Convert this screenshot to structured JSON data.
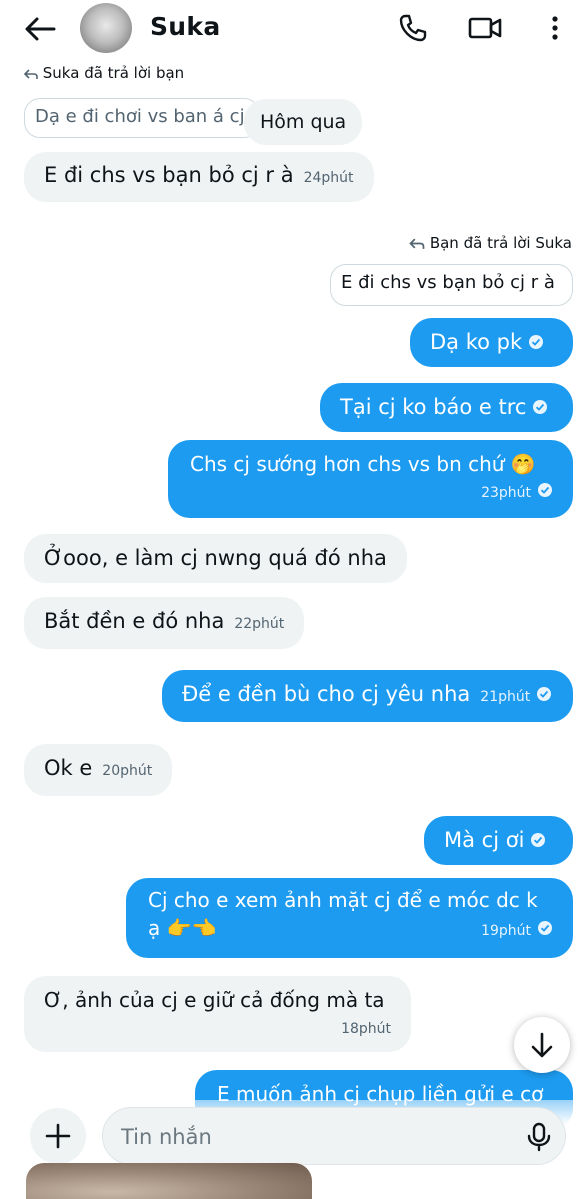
{
  "header": {
    "name": "Suka",
    "back_icon": "arrow-left-icon",
    "call_icon": "phone-icon",
    "video_icon": "video-camera-icon",
    "more_icon": "more-vertical-icon"
  },
  "thread": {
    "top_reply_label": "Suka đã trả lời bạn",
    "top_quote": "Dạ e đi chơi vs ban á cj",
    "date_pill": "Hôm qua",
    "m1": {
      "text": "E đi chs vs bạn bỏ cj r à",
      "time": "24phút"
    },
    "self_reply_label": "Bạn đã trả lời Suka",
    "self_quote": "E đi chs vs bạn bỏ cj r à",
    "m2": {
      "text": "Dạ ko pk"
    },
    "m3": {
      "text": "Tại cj ko báo e trc"
    },
    "m4": {
      "text": "Chs cj sướng hơn chs vs bn chứ 🤭",
      "time": "23phút"
    },
    "m5": {
      "text": "Ởooo, e làm cj nwng quá đó nha"
    },
    "m6": {
      "text": "Bắt đền e đó nha",
      "time": "22phút"
    },
    "m7": {
      "text": "Để e đền bù cho cj yêu nha",
      "time": "21phút"
    },
    "m8": {
      "text": "Ok e",
      "time": "20phút"
    },
    "m9": {
      "text": "Mà cj ơi"
    },
    "m10": {
      "line1": "Cj cho e xem ảnh mặt cj để e móc dc k",
      "line2": "ạ 👉👈",
      "time": "19phút"
    },
    "m11": {
      "text": "Ơ, ảnh của cj e giữ cả đống mà ta",
      "time": "18phút"
    },
    "m12": {
      "text": "E muốn ảnh cj chụp liền gửi e cơ"
    }
  },
  "composer": {
    "placeholder": "Tin nhắn",
    "plus_icon": "plus-icon",
    "mic_icon": "microphone-icon",
    "scroll_icon": "arrow-down-icon"
  },
  "colors": {
    "accent": "#1d9bf0",
    "incoming": "#eff3f4"
  }
}
